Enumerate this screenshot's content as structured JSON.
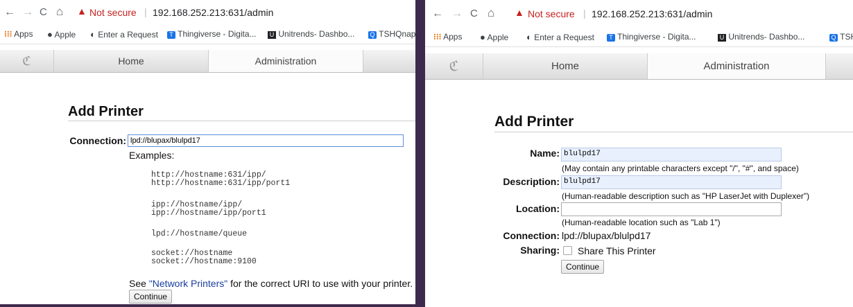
{
  "browser": {
    "nav": {
      "back": "←",
      "forward": "→",
      "reload": "C",
      "home": "⌂"
    },
    "security": {
      "icon": "warning-triangle-icon",
      "label": "Not secure"
    },
    "url": "192.168.252.213:631/admin",
    "bookmarks": [
      {
        "label": "Apps",
        "icon": "apps-grid-icon"
      },
      {
        "label": "Apple",
        "icon": "apple-icon"
      },
      {
        "label": "Enter a Request",
        "icon": "globe-icon"
      },
      {
        "label": "Thingiverse - Digita...",
        "icon": "thingiverse-icon"
      },
      {
        "label": "Unitrends- Dashbo...",
        "icon": "unitrends-icon"
      },
      {
        "label": "TSHQnap",
        "icon": "qnap-icon"
      }
    ],
    "bookmark_cut_right": "TSH"
  },
  "cups_nav": {
    "tabs": [
      "Home",
      "Administration"
    ],
    "active": "Administration",
    "logo_icon": "cups-logo-icon"
  },
  "left_page": {
    "title": "Add Printer",
    "connection_label": "Connection:",
    "connection_value": "lpd://blupax/blulpd17",
    "examples_label": "Examples:",
    "examples": [
      "http://hostname:631/ipp/\nhttp://hostname:631/ipp/port1",
      "ipp://hostname/ipp/\nipp://hostname/ipp/port1",
      "lpd://hostname/queue",
      "socket://hostname\nsocket://hostname:9100"
    ],
    "see_prefix": "See ",
    "see_link": "\"Network Printers\"",
    "see_suffix": " for the correct URI to use with your printer.",
    "continue_label": "Continue"
  },
  "right_page": {
    "title": "Add Printer",
    "name_label": "Name:",
    "name_value": "blulpd17",
    "name_hint": "(May contain any printable characters except \"/\", \"#\", and space)",
    "description_label": "Description:",
    "description_value": "blulpd17",
    "description_hint": "(Human-readable description such as \"HP LaserJet with Duplexer\")",
    "location_label": "Location:",
    "location_value": "",
    "location_hint": "(Human-readable location such as \"Lab 1\")",
    "connection_label": "Connection:",
    "connection_value": "lpd://blupax/blulpd17",
    "sharing_label": "Sharing:",
    "sharing_option": "Share This Printer",
    "sharing_checked": false,
    "continue_label": "Continue"
  }
}
